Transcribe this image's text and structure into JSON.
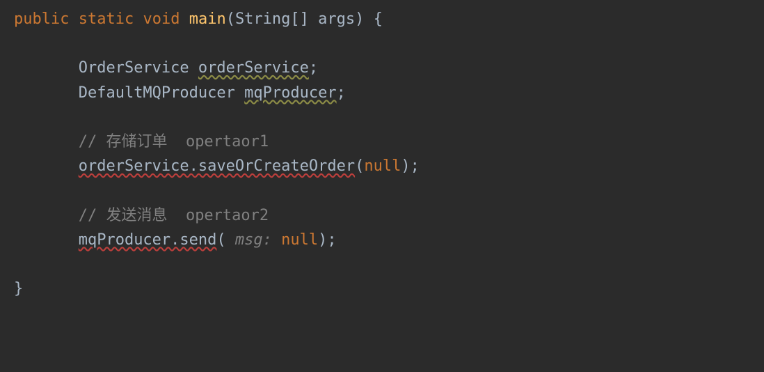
{
  "code": {
    "kw_public": "public",
    "kw_static": "static",
    "kw_void": "void",
    "method_main": "main",
    "paren_open": "(",
    "type_string": "String",
    "brackets": "[]",
    "param_args": "args",
    "paren_close": ")",
    "brace_open": "{",
    "type_order_service": "OrderService",
    "var_order_service": "orderService",
    "semicolon": ";",
    "type_default_mq_producer": "DefaultMQProducer",
    "var_mq_producer": "mqProducer",
    "comment1": "// 存储订单  opertaor1",
    "call_save_or_create": "orderService.saveOrCreateOrder",
    "kw_null": "null",
    "comment2": "// 发送消息  opertaor2",
    "call_send": "mqProducer.send",
    "hint_msg": " msg: ",
    "brace_close": "}"
  }
}
